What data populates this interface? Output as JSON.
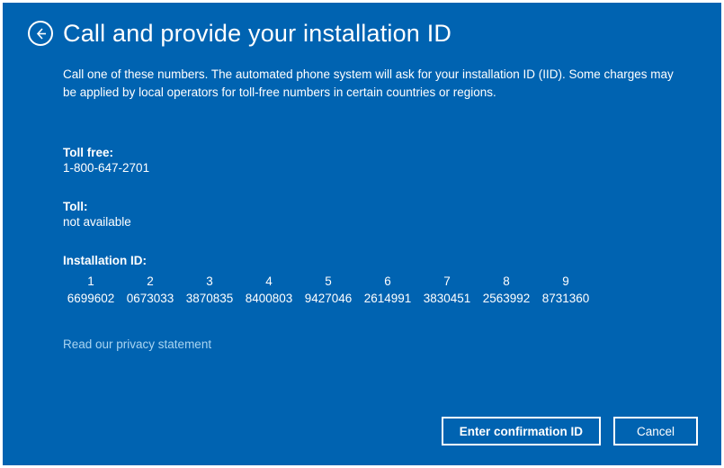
{
  "title": "Call and provide your installation ID",
  "description": "Call one of these numbers. The automated phone system will ask for your installation ID (IID). Some charges may be applied by local operators for toll-free numbers in certain countries or regions.",
  "toll_free": {
    "label": "Toll free:",
    "value": "1-800-647-2701"
  },
  "toll": {
    "label": "Toll:",
    "value": "not available"
  },
  "installation_id": {
    "label": "Installation ID:",
    "headers": [
      "1",
      "2",
      "3",
      "4",
      "5",
      "6",
      "7",
      "8",
      "9"
    ],
    "groups": [
      "6699602",
      "0673033",
      "3870835",
      "8400803",
      "9427046",
      "2614991",
      "3830451",
      "2563992",
      "8731360"
    ]
  },
  "privacy_link": "Read our privacy statement",
  "buttons": {
    "confirm": "Enter confirmation ID",
    "cancel": "Cancel"
  }
}
